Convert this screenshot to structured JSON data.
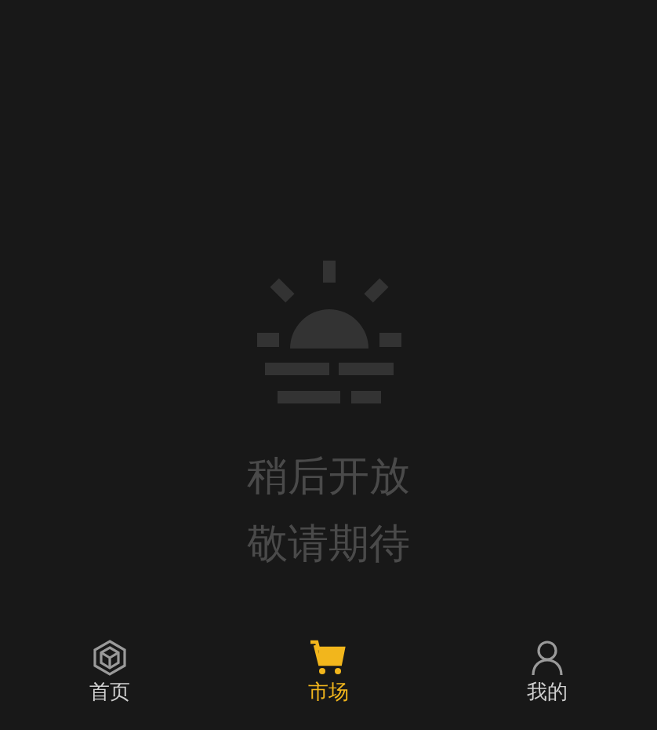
{
  "notice": {
    "lines": [
      "稍后开放",
      "敬请期待"
    ]
  },
  "tabs": [
    {
      "kind": "home",
      "label": "首页",
      "selected": false
    },
    {
      "kind": "market",
      "label": "市场",
      "selected": true
    },
    {
      "kind": "profile",
      "label": "我的",
      "selected": false
    }
  ]
}
